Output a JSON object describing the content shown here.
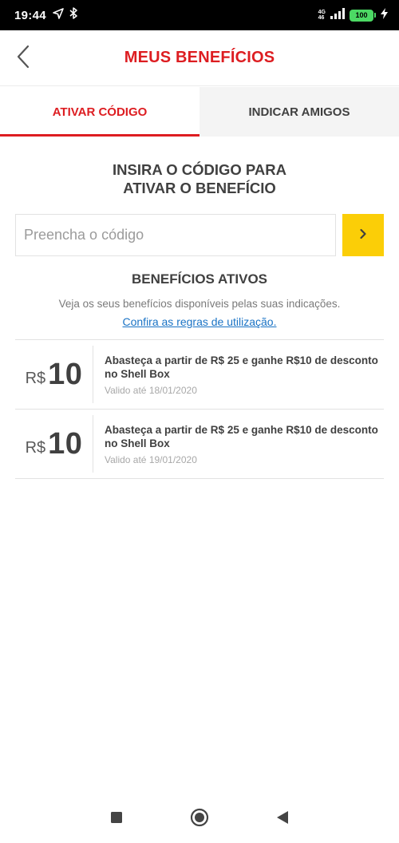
{
  "status_bar": {
    "time": "19:44",
    "network": [
      "4G",
      "46"
    ],
    "battery": "100"
  },
  "header": {
    "title": "MEUS BENEFÍCIOS"
  },
  "tabs": [
    {
      "label": "ATIVAR CÓDIGO",
      "active": true
    },
    {
      "label": "INDICAR AMIGOS",
      "active": false
    }
  ],
  "activate": {
    "title_line1": "INSIRA O CÓDIGO PARA",
    "title_line2": "ATIVAR O BENEFÍCIO",
    "input_placeholder": "Preencha o código",
    "input_value": ""
  },
  "active_benefits": {
    "title": "BENEFÍCIOS ATIVOS",
    "description": "Veja os seus benefícios disponíveis pelas suas indicações.",
    "rules_link": "Confira as regras de utilização.",
    "items": [
      {
        "currency": "R$",
        "amount": "10",
        "description": "Abasteça a partir de R$ 25 e ganhe R$10 de desconto no Shell Box",
        "valid_until": "Valido até 18/01/2020"
      },
      {
        "currency": "R$",
        "amount": "10",
        "description": "Abasteça a partir de R$ 25 e ganhe R$10 de desconto no Shell Box",
        "valid_until": "Valido até 19/01/2020"
      }
    ]
  },
  "colors": {
    "brand_red": "#dd1d21",
    "brand_yellow": "#fbce07",
    "link_blue": "#1a73c5"
  },
  "icons": [
    "navigation-arrow-icon",
    "bluetooth-icon",
    "signal-icon",
    "battery-icon",
    "charging-icon",
    "back-chevron-icon",
    "chevron-right-icon",
    "recents-square-icon",
    "home-circle-icon",
    "back-triangle-icon"
  ]
}
